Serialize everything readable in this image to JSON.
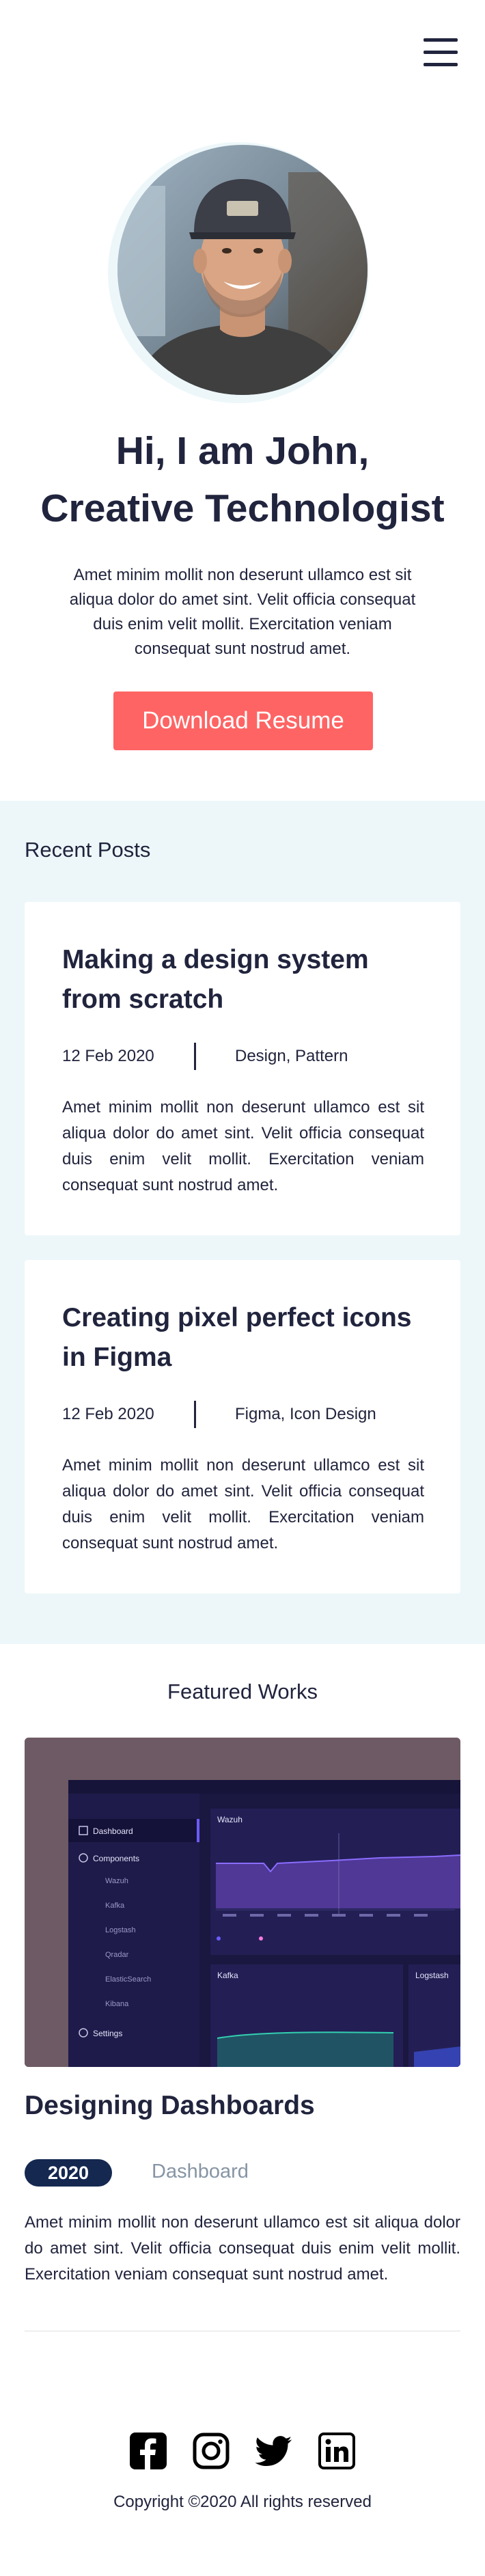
{
  "header": {
    "menu_icon": "hamburger-menu-icon"
  },
  "hero": {
    "avatar_icon": "profile-photo",
    "title_line1": "Hi, I am John,",
    "title_line2": "Creative Technologist",
    "description": "Amet minim mollit non deserunt ullamco est sit aliqua dolor do amet sint. Velit officia consequat duis enim velit mollit. Exercitation veniam consequat sunt nostrud amet.",
    "button_label": "Download Resume",
    "colors": {
      "accent": "#FF6464",
      "dark": "#21243D",
      "soft_bg": "#EDF7FA"
    }
  },
  "recent_posts": {
    "title": "Recent Posts",
    "posts": [
      {
        "title": "Making a design system from scratch",
        "date": "12 Feb 2020",
        "tags": "Design, Pattern",
        "body": "Amet minim mollit non deserunt ullamco est sit aliqua dolor do amet sint. Velit officia consequat duis enim velit mollit. Exercitation veniam consequat sunt nostrud amet."
      },
      {
        "title": "Creating pixel perfect icons in Figma",
        "date": "12 Feb 2020",
        "tags": "Figma, Icon Design",
        "body": "Amet minim mollit non deserunt ullamco est sit aliqua dolor do amet sint. Velit officia consequat duis enim velit mollit. Exercitation veniam consequat sunt nostrud amet."
      }
    ]
  },
  "featured": {
    "title": "Featured Works",
    "works": [
      {
        "title": "Designing Dashboards",
        "year": "2020",
        "category": "Dashboard",
        "description": "Amet minim mollit non deserunt ullamco est sit aliqua dolor do amet sint. Velit officia consequat duis enim velit mollit. Exercitation veniam consequat sunt nostrud amet.",
        "thumbnail": {
          "nav": [
            "Dashboard",
            "Components",
            "Wazuh",
            "Kafka",
            "Logstash",
            "Qradar",
            "ElasticSearch",
            "Kibana",
            "Settings"
          ],
          "panel_top_title": "Wazuh",
          "panel_kafka_title": "Kafka",
          "panel_logstash_title": "Logstash"
        }
      }
    ],
    "colors": {
      "badge": "#142850",
      "muted": "#8695A4"
    }
  },
  "footer": {
    "social": [
      "facebook-icon",
      "instagram-icon",
      "twitter-icon",
      "linkedin-icon"
    ],
    "copyright": "Copyright ©2020 All rights reserved"
  }
}
